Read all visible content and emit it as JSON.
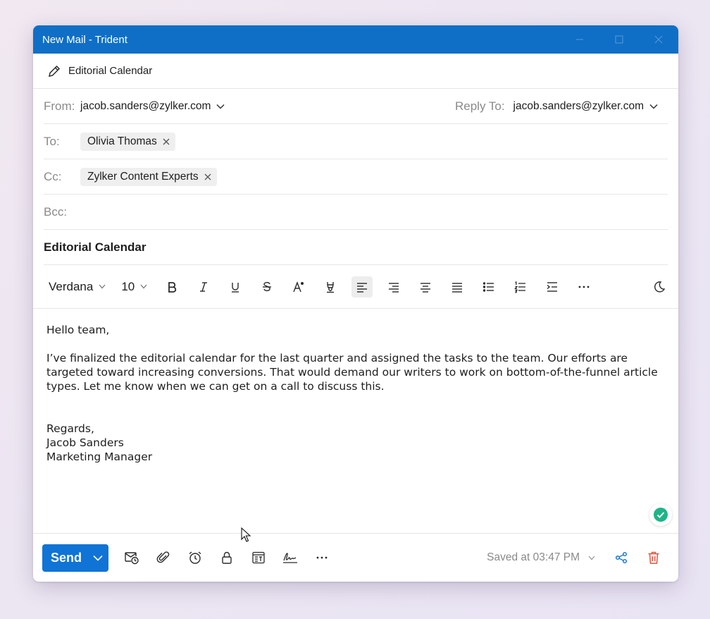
{
  "window": {
    "title": "New Mail - Trident",
    "controls": [
      "minimize-icon",
      "maximize-icon",
      "close-icon"
    ]
  },
  "draft": {
    "name": "Editorial Calendar",
    "icon": "pencil-icon"
  },
  "from": {
    "label": "From:",
    "value": "jacob.sanders@zylker.com"
  },
  "reply_to": {
    "label": "Reply To:",
    "value": "jacob.sanders@zylker.com"
  },
  "to": {
    "label": "To:",
    "recipients": [
      "Olivia Thomas"
    ]
  },
  "cc": {
    "label": "Cc:",
    "recipients": [
      "Zylker Content Experts"
    ]
  },
  "bcc": {
    "label": "Bcc:",
    "recipients": []
  },
  "subject": "Editorial Calendar",
  "toolbar": {
    "font": "Verdana",
    "size": "10",
    "icons": [
      "bold-icon",
      "italic-icon",
      "underline-icon",
      "strikethrough-icon",
      "font-color-icon",
      "highlight-icon",
      "align-left-icon",
      "align-right-icon",
      "align-center-icon",
      "justify-icon",
      "bullet-list-icon",
      "numbered-list-icon",
      "indent-icon",
      "more-icon",
      "dark-mode-icon"
    ],
    "active": "align-left-icon"
  },
  "body": {
    "greeting": "Hello team,",
    "paragraph": "I’ve finalized the editorial calendar for the last quarter and assigned the tasks to the team. Our efforts are targeted toward increasing conversions. That would demand our writers to work on bottom-of-the-funnel article types. Let me know when we can get on a call to discuss this.",
    "closing": "Regards,",
    "sender_name": "Jacob Sanders",
    "sender_title": "Marketing Manager"
  },
  "footer": {
    "send_label": "Send",
    "icons": [
      "schedule-send-icon",
      "attachment-icon",
      "reminder-icon",
      "lock-icon",
      "template-icon",
      "signature-icon",
      "more-icon"
    ],
    "saved_text": "Saved at 03:47 PM"
  },
  "colors": {
    "accent": "#0f6fc6",
    "send": "#0f74d6",
    "delete": "#e0523f",
    "check": "#1fb487",
    "share": "#1a7ad4"
  }
}
